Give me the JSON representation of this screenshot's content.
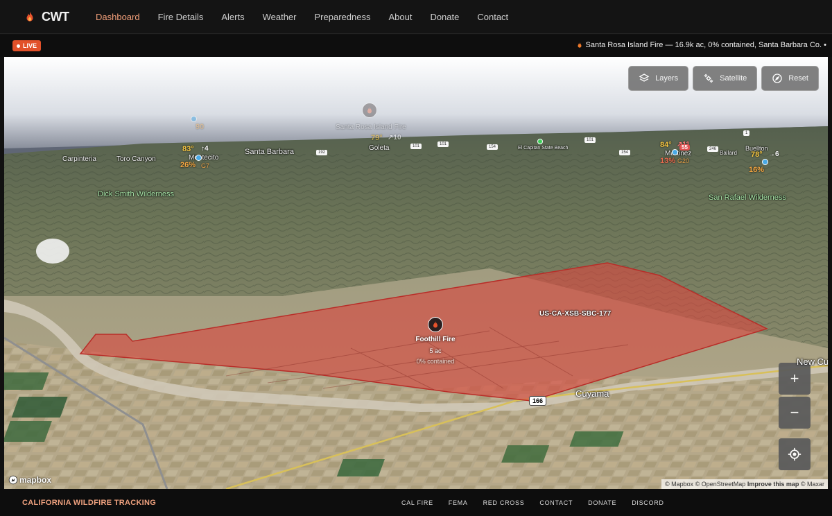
{
  "nav": {
    "brand": "CWT",
    "links": [
      "Dashboard",
      "Fire Details",
      "Alerts",
      "Weather",
      "Preparedness",
      "About",
      "Donate",
      "Contact"
    ],
    "active": "Dashboard"
  },
  "ticker": {
    "live_label": "LIVE",
    "text": "Santa Rosa Island Fire — 16.9k ac, 0% contained, Santa Barbara Co. •"
  },
  "map": {
    "controls": {
      "layers": "Layers",
      "satellite": "Satellite",
      "reset": "Reset",
      "zoom_in": "+",
      "zoom_out": "−"
    },
    "places": {
      "carpinteria": "Carpinteria",
      "toro_canyon": "Toro Canyon",
      "montecito": "Montecito",
      "santa_barbara": "Santa Barbara",
      "goleta": "Goleta",
      "el_capitan": "El Capitan State Beach",
      "ballard": "Ballard",
      "buellton": "Buellton",
      "martinez": "Martinez",
      "cuyama": "Cuyama",
      "new_cuyama": "New Cu",
      "santa_rosa_fire": "Santa Rosa Island Fire"
    },
    "wilderness": {
      "dick_smith": "Dick Smith Wilderness",
      "san_rafael": "San Rafael Wilderness"
    },
    "weather": {
      "montecito": {
        "temp": "83°",
        "wind": "4",
        "humidity": "26%",
        "gust": "G7"
      },
      "goleta": {
        "temp": "79°",
        "wind": "10"
      },
      "sb_island": {
        "temp": "90"
      },
      "martinez": {
        "temp": "84°",
        "wind": "11",
        "humidity": "13%",
        "gust": "G20",
        "badge": "55"
      },
      "buellton": {
        "temp": "78°",
        "wind": "6",
        "humidity": "16%"
      }
    },
    "routes": {
      "main": "166",
      "r101a": "101",
      "r101b": "101",
      "r192": "192",
      "r154a": "154",
      "r154b": "154",
      "r246": "246",
      "r1": "1",
      "r101c": "101"
    },
    "fire": {
      "id": "US-CA-XSB-SBC-177",
      "name": "Foothill Fire",
      "acres": "5 ac",
      "containment": "0% contained"
    },
    "branding": "mapbox",
    "attribution": {
      "a1": "© Mapbox",
      "a2": "© OpenStreetMap",
      "a3": "Improve this map",
      "a4": "© Maxar"
    }
  },
  "footer": {
    "title": "CALIFORNIA WILDFIRE TRACKING",
    "links": [
      "CAL FIRE",
      "FEMA",
      "RED CROSS",
      "CONTACT",
      "DONATE",
      "DISCORD"
    ]
  },
  "colors": {
    "accent": "#f3a07a",
    "live": "#e2512a",
    "fire_fill": "#d9473f"
  }
}
